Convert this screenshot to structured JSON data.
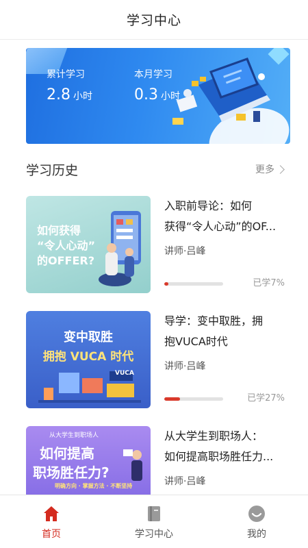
{
  "header": {
    "title": "学习中心"
  },
  "banner": {
    "total_label": "累计学习",
    "total_value": "2.8",
    "total_unit": "小时",
    "month_label": "本月学习",
    "month_value": "0.3",
    "month_unit": "小时"
  },
  "history": {
    "title": "学习历史",
    "more_label": "更多"
  },
  "courses": [
    {
      "title_line1": "入职前导论：如何",
      "title_line2": "获得“令人心动”的OF...",
      "lecturer": "讲师·吕峰",
      "progress_label": "已学7%",
      "progress": 0.07,
      "thumb_text": [
        "如何获得",
        "“令人心动”",
        "的OFFER?"
      ]
    },
    {
      "title_line1": "导学：变中取胜，拥",
      "title_line2": "抱VUCA时代",
      "lecturer": "讲师·吕峰",
      "progress_label": "已学27%",
      "progress": 0.27,
      "thumb_text": [
        "变中取胜",
        "拥抱 VUCA 时代",
        "VUCA"
      ]
    },
    {
      "title_line1": "从大学生到职场人：",
      "title_line2": "如何提高职场胜任力...",
      "lecturer": "讲师·吕峰",
      "thumb_text": [
        "从大学生到职场人",
        "如何提高",
        "职场胜任力?",
        "明确方向 · 掌握方法 · 不断坚持"
      ]
    }
  ],
  "tabbar": {
    "items": [
      {
        "label": "首页",
        "icon": "home-icon",
        "active": true
      },
      {
        "label": "学习中心",
        "icon": "book-icon",
        "active": false
      },
      {
        "label": "我的",
        "icon": "profile-icon",
        "active": false
      }
    ]
  },
  "colors": {
    "accent": "#d42b1f",
    "banner": "#2f8af0",
    "progress": "#d93a2b"
  }
}
